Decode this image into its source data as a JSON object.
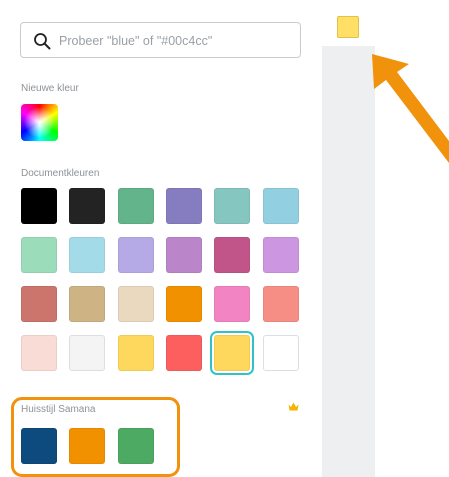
{
  "search": {
    "placeholder": "Probeer \"blue\" of \"#00c4cc\""
  },
  "sections": {
    "new_color_label": "Nieuwe kleur",
    "document_label": "Documentkleuren",
    "brand_label": "Huisstijl Samana"
  },
  "document_colors": [
    [
      "#000000",
      "#232323",
      "#63b38b",
      "#857dc0",
      "#85c6c1",
      "#92cfe0"
    ],
    [
      "#9bdcba",
      "#a3dbe8",
      "#b6aae6",
      "#bb86c9",
      "#c1558a",
      "#cd96e0"
    ],
    [
      "#cc756c",
      "#ceb384",
      "#ead9bf",
      "#f29100",
      "#f384c4",
      "#f68e86"
    ],
    [
      "#f8dcd5",
      "#f4f4f4",
      "#fdd85c",
      "#fd5f5f",
      "#fdd85c",
      "#ffffff"
    ]
  ],
  "selected_document_color": "#fdd85c",
  "brand_colors": [
    "#0d4a7e",
    "#f29100",
    "#4daa63"
  ],
  "current_color": "#ffdf66",
  "accents": {
    "annotation_orange": "#f0920b",
    "selection_teal": "#2ec4c7",
    "crown": "#f5b400"
  },
  "icons": [
    "search-icon",
    "crown-icon",
    "annotation-arrow"
  ]
}
